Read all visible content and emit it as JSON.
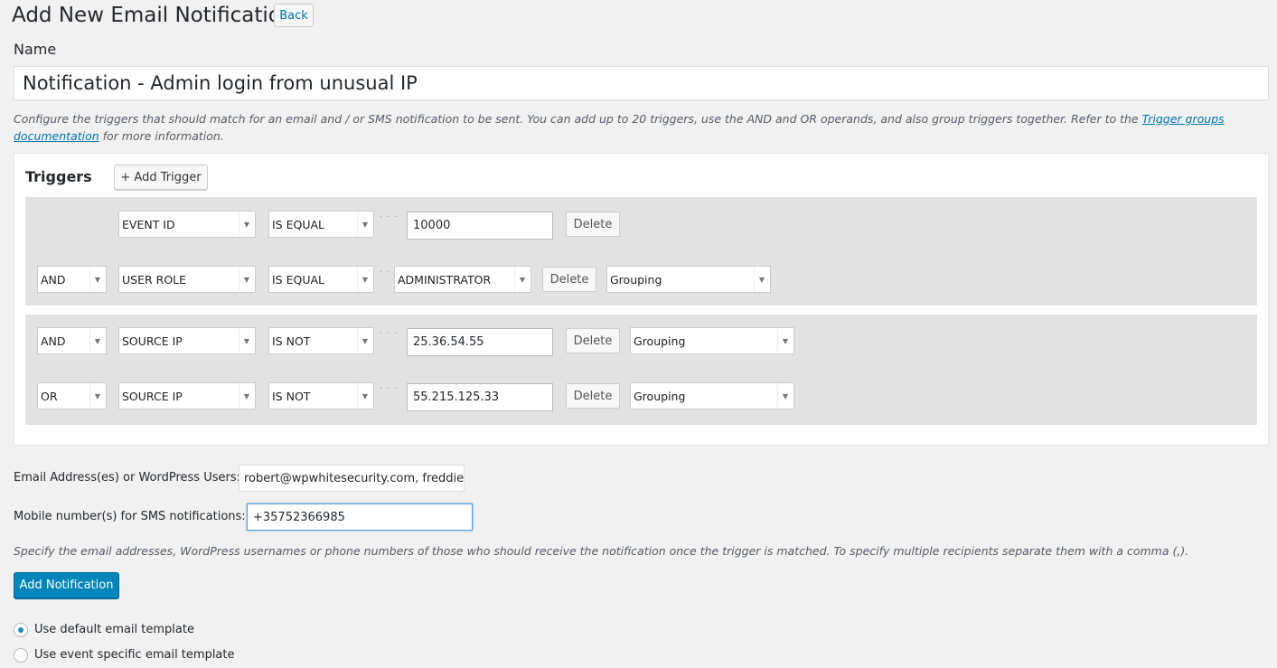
{
  "page": {
    "title": "Add New Email Notification",
    "back_label": "Back"
  },
  "name_field": {
    "label": "Name",
    "value": "Notification - Admin login from unusual IP"
  },
  "description": {
    "text_before": "Configure the triggers that should match for an email and / or SMS notification to be sent. You can add up to 20 triggers, use the AND and OR operands, and also group triggers together. Refer to the ",
    "link_text": "Trigger groups documentation",
    "text_after": " for more information."
  },
  "triggers": {
    "title": "Triggers",
    "add_label": "+ Add Trigger",
    "delete_label": "Delete",
    "dots": "· · ·",
    "rows": [
      {
        "operand": "",
        "field": "EVENT ID",
        "condition": "IS EQUAL",
        "value": "10000",
        "grouping": ""
      },
      {
        "operand": "AND",
        "field": "USER ROLE",
        "condition": "IS EQUAL",
        "value": "ADMINISTRATOR",
        "grouping": "Grouping"
      },
      {
        "operand": "AND",
        "field": "SOURCE IP",
        "condition": "IS NOT",
        "value": "25.36.54.55",
        "grouping": "Grouping"
      },
      {
        "operand": "OR",
        "field": "SOURCE IP",
        "condition": "IS NOT",
        "value": "55.215.125.33",
        "grouping": "Grouping"
      }
    ]
  },
  "recipients": {
    "email_label": "Email Address(es) or WordPress Users:",
    "email_value": "robert@wpwhitesecurity.com, freddiep",
    "mobile_label": "Mobile number(s) for SMS notifications:",
    "mobile_value": "+35752366985",
    "help": "Specify the email addresses, WordPress usernames or phone numbers of those who should receive the notification once the trigger is matched. To specify multiple recipients separate them with a comma (,)."
  },
  "submit_label": "Add Notification",
  "template_options": [
    {
      "label": "Use default email template",
      "checked": true
    },
    {
      "label": "Use event specific email template",
      "checked": false
    }
  ],
  "colors": {
    "primary": "#0085ba",
    "link": "#0073aa",
    "group_background": "#e2e2e2"
  }
}
